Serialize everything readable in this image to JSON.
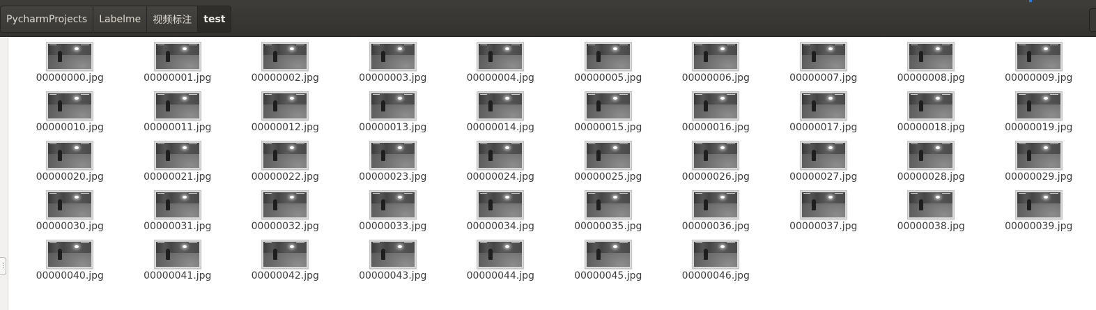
{
  "breadcrumbs": [
    "PycharmProjects",
    "Labelme",
    "视频标注",
    "test"
  ],
  "active_crumb": "test",
  "files": [
    "00000000.jpg",
    "00000001.jpg",
    "00000002.jpg",
    "00000003.jpg",
    "00000004.jpg",
    "00000005.jpg",
    "00000006.jpg",
    "00000007.jpg",
    "00000008.jpg",
    "00000009.jpg",
    "00000010.jpg",
    "00000011.jpg",
    "00000012.jpg",
    "00000013.jpg",
    "00000014.jpg",
    "00000015.jpg",
    "00000016.jpg",
    "00000017.jpg",
    "00000018.jpg",
    "00000019.jpg",
    "00000020.jpg",
    "00000021.jpg",
    "00000022.jpg",
    "00000023.jpg",
    "00000024.jpg",
    "00000025.jpg",
    "00000026.jpg",
    "00000027.jpg",
    "00000028.jpg",
    "00000029.jpg",
    "00000030.jpg",
    "00000031.jpg",
    "00000032.jpg",
    "00000033.jpg",
    "00000034.jpg",
    "00000035.jpg",
    "00000036.jpg",
    "00000037.jpg",
    "00000038.jpg",
    "00000039.jpg",
    "00000040.jpg",
    "00000041.jpg",
    "00000042.jpg",
    "00000043.jpg",
    "00000044.jpg",
    "00000045.jpg",
    "00000046.jpg"
  ],
  "icons": {
    "thumbnail": "image-thumbnail-icon",
    "sidebar_handle": "pane-resize-handle-icon"
  },
  "colors": {
    "header_bg": "#3a3935",
    "crumb_text": "#dfdbd2",
    "accent": "#2f7fe0",
    "file_label": "#3c3c3c"
  }
}
